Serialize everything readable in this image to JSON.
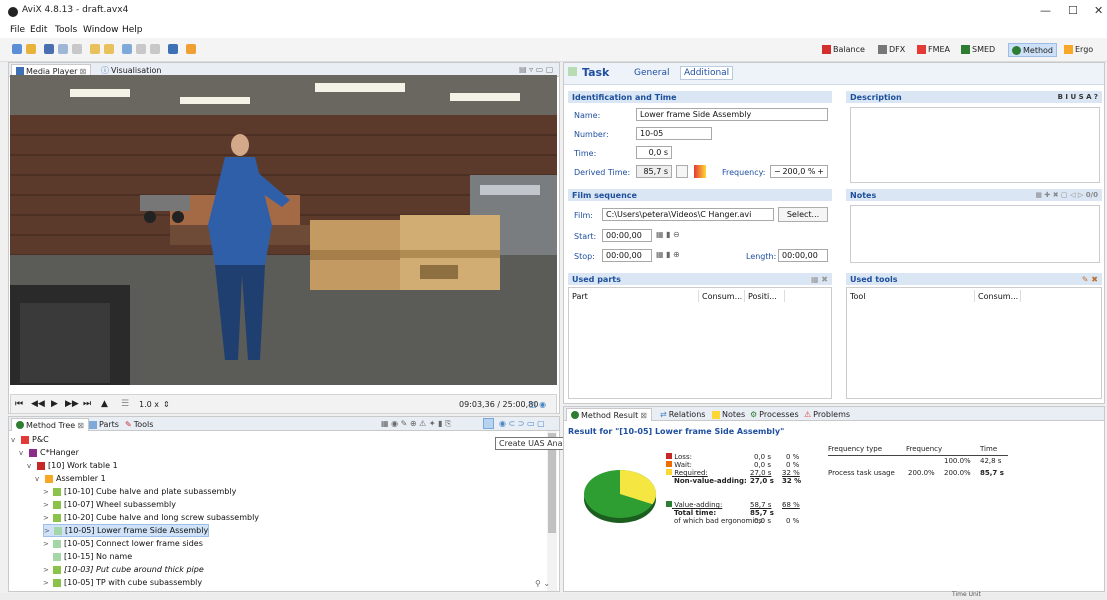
{
  "window": {
    "title": "AviX 4.8.13 - draft.avx4",
    "minimize": "—",
    "maximize": "☐",
    "close": "✕"
  },
  "menu": [
    "File",
    "Edit",
    "Tools",
    "Window",
    "Help"
  ],
  "perspectives": [
    {
      "label": "Balance",
      "color": "#d32f2f"
    },
    {
      "label": "DFX",
      "color": "#777"
    },
    {
      "label": "FMEA",
      "color": "#e53935"
    },
    {
      "label": "SMED",
      "color": "#2e7d32"
    },
    {
      "label": "Method",
      "color": "#2e7d32",
      "active": true
    },
    {
      "label": "Ergo",
      "color": "#f9a825"
    }
  ],
  "left_tabs": {
    "media": "Media Player",
    "vis": "Visualisation"
  },
  "player": {
    "speed": "1.0 x",
    "timecode": "09:03,36 / 25:00,80",
    "buttons": [
      "⏮",
      "◀◀",
      "▶",
      "▶▶",
      "⏭",
      "▲"
    ]
  },
  "bottom_tabs": {
    "tree": "Method Tree",
    "parts": "Parts",
    "tools": "Tools"
  },
  "tooltip": "Create UAS Analysis",
  "tree": [
    {
      "label": "P&C",
      "level": 0,
      "arrow": "v",
      "icon": "#e53935"
    },
    {
      "label": "C*Hanger",
      "level": 1,
      "arrow": "v",
      "icon": "#8b2c8b"
    },
    {
      "label": "[10] Work table 1",
      "level": 2,
      "arrow": "v",
      "icon": "#c62828"
    },
    {
      "label": "Assembler 1",
      "level": 3,
      "arrow": "v",
      "icon": "#f9a825"
    },
    {
      "label": "[10-10] Cube halve and plate subassembly",
      "level": 4,
      "arrow": ">",
      "icon": "#8bc34a"
    },
    {
      "label": "[10-07] Wheel subassembly",
      "level": 4,
      "arrow": ">",
      "icon": "#8bc34a"
    },
    {
      "label": "[10-20] Cube halve and long screw subassembly",
      "level": 4,
      "arrow": ">",
      "icon": "#8bc34a"
    },
    {
      "label": "[10-05] Lower frame Side Assembly",
      "level": 4,
      "arrow": ">",
      "icon": "#a5d6a7",
      "selected": true
    },
    {
      "label": "[10-05] Connect lower frame sides",
      "level": 4,
      "arrow": ">",
      "icon": "#a5d6a7"
    },
    {
      "label": "[10-15] No name",
      "level": 4,
      "arrow": "",
      "icon": "#a5d6a7"
    },
    {
      "label": "[10-03] Put cube around thick pipe",
      "level": 4,
      "arrow": ">",
      "icon": "#8bc34a",
      "italic": true
    },
    {
      "label": "[10-05] TP with cube subassembly",
      "level": 4,
      "arrow": ">",
      "icon": "#8bc34a"
    }
  ],
  "task": {
    "header": "Task",
    "tabs": [
      "General",
      "Additional"
    ],
    "ident_header": "Identification and Time",
    "name_label": "Name:",
    "name": "Lower frame Side Assembly",
    "number_label": "Number:",
    "number": "10-05",
    "time_label": "Time:",
    "time": "0,0 s",
    "derived_label": "Derived Time:",
    "derived": "85,7 s",
    "freq_label": "Frequency:",
    "freq": "200,0 %",
    "freq_minus": "−",
    "freq_plus": "+",
    "desc_header": "Description",
    "film_header": "Film sequence",
    "film_label": "Film:",
    "film": "C:\\Users\\petera\\Videos\\C Hanger.avi",
    "select": "Select...",
    "start_label": "Start:",
    "start": "00:00,00",
    "stop_label": "Stop:",
    "stop": "00:00,00",
    "length_label": "Length:",
    "length": "00:00,00",
    "notes_header": "Notes",
    "parts_header": "Used parts",
    "parts_cols": [
      "Part",
      "Consum...",
      "Positi..."
    ],
    "tools_header": "Used tools",
    "tools_cols": [
      "Tool",
      "Consum..."
    ]
  },
  "result_tabs": [
    "Method Result",
    "Relations",
    "Notes",
    "Processes",
    "Problems"
  ],
  "result": {
    "title": "Result for \"[10-05] Lower frame Side Assembly\"",
    "rows": [
      {
        "label": "Loss:",
        "val": "0,0 s",
        "pct": "0 %",
        "color": "#c62828"
      },
      {
        "label": "Wait:",
        "val": "0,0 s",
        "pct": "0 %",
        "color": "#ef6c00"
      },
      {
        "label": "Required:",
        "val": "27,0 s",
        "pct": "32 %",
        "color": "#fdd835"
      }
    ],
    "nva_label": "Non-value-adding:",
    "nva_val": "27,0 s",
    "nva_pct": "32 %",
    "va_label": "Value-adding:",
    "va_val": "58,7 s",
    "va_pct": "68 %",
    "va_color": "#2e7d32",
    "total_label": "Total time:",
    "total_val": "85,7 s",
    "ergo_label": "of which bad ergonomics:",
    "ergo_val": "0,0 s",
    "ergo_pct": "0 %",
    "pie_value_adding": 0.68,
    "freq_cols": [
      "Frequency type",
      "Frequency",
      "Time"
    ],
    "freq_row1": {
      "c1": "100.0%",
      "c2": "42,8 s"
    },
    "freq_row2": {
      "type": "Process task usage",
      "c0": "200.0%",
      "c1": "200.0%",
      "c2": "85,7 s"
    }
  },
  "status": {
    "time_unit": "Time Unit"
  }
}
